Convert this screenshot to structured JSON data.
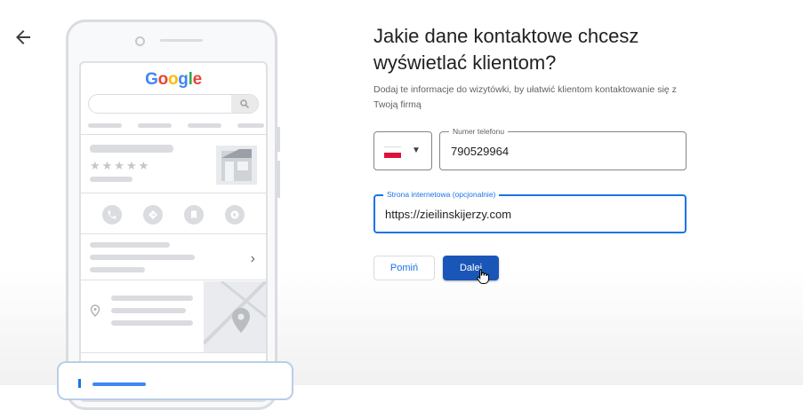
{
  "nav": {
    "back_icon": "arrow-left-icon"
  },
  "preview": {
    "logo": [
      "G",
      "o",
      "o",
      "g",
      "l",
      "e"
    ],
    "logo_colors": [
      "#4285f4",
      "#ea4335",
      "#fbbc05",
      "#4285f4",
      "#34a853",
      "#ea4335"
    ],
    "stars": "★★★★★",
    "action_icons": [
      "phone-icon",
      "directions-icon",
      "bookmark-icon",
      "website-icon"
    ],
    "chevron": "›"
  },
  "form": {
    "title": "Jakie dane kontaktowe chcesz wyświetlać klientom?",
    "subtitle": "Dodaj te informacje do wizytówki, by ułatwić klientom kontaktowanie się z Twoją firmą",
    "country": {
      "flag": "PL",
      "caret": "▼"
    },
    "phone": {
      "label": "Numer telefonu",
      "value": "790529964"
    },
    "website": {
      "label": "Strona internetowa (opcjonalnie)",
      "value": "https://zieilinskijerzy.com"
    },
    "skip_label": "Pomiń",
    "next_label": "Dalej"
  },
  "colors": {
    "accent": "#1a73e8",
    "primary_button": "#1a56b8",
    "border": "#80868b"
  }
}
